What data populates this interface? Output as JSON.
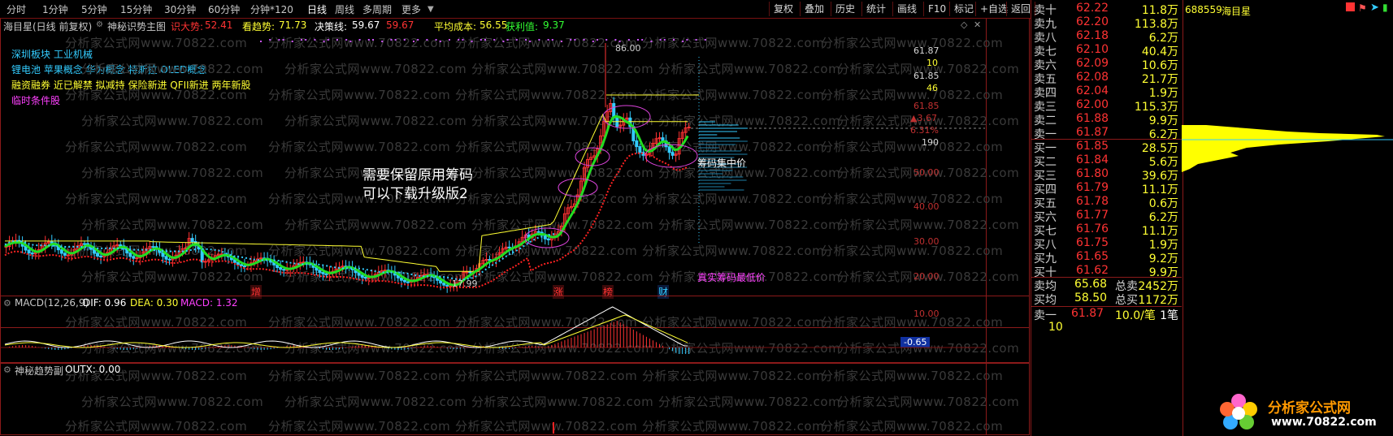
{
  "toolbar": {
    "periods": [
      "分时",
      "1分钟",
      "5分钟",
      "15分钟",
      "30分钟",
      "60分钟",
      "分钟*120",
      "日线",
      "周线",
      "多周期",
      "更多"
    ],
    "active_period": "日线",
    "right_buttons": [
      "复权",
      "叠加",
      "历史",
      "统计",
      "画线",
      "F10",
      "标记",
      "+自选",
      "返回"
    ]
  },
  "info": {
    "stock_label": "海目星(日线 前复权)",
    "indicator_name": "神秘识势主图",
    "sell_label": "识大势:",
    "sell_value": "52.41",
    "trend_label": "看趋势:",
    "trend_value": "71.73",
    "decision_label": "决策线:",
    "decision_value": "59.67",
    "decision_value2": "59.67",
    "avg_cost_label": "平均成本:",
    "avg_cost_value": "56.55",
    "profit_label": "获利值:",
    "profit_value": "9.37"
  },
  "concepts": {
    "line1": "深圳板块  工业机械",
    "line2": "锂电池  苹果概念  华为概念  特斯拉  OLED概念",
    "line3": "融资融券  近已解禁  拟减持  保险新进  QFII新进  两年新股",
    "line4": "临时条件股"
  },
  "annotations": {
    "note_line1": "需要保留原用筹码",
    "note_line2": "可以下载升级版2",
    "chip_center": "筹码集中价",
    "lowest_chip": "真实筹码最低价",
    "high_price": "86.00",
    "low_price": "17.99",
    "markers": [
      "增",
      "涨",
      "榜",
      "财"
    ]
  },
  "price_axis": {
    "top_value": "61.87",
    "top_sub": "10",
    "mid_value": "61.85",
    "mid_sub": "46",
    "current_price": "61.85",
    "change": "▲3.67",
    "change_pct": "6.31%",
    "vol_tag": "190",
    "ticks": [
      "50.00",
      "40.00",
      "30.00",
      "20.00"
    ]
  },
  "macd": {
    "title": "MACD(12,26,9)",
    "dif_label": "DIF: 0.96",
    "dea_label": "DEA: 0.30",
    "macd_label": "MACD: 1.32",
    "axis_top": "10.00",
    "axis_value": "-0.65"
  },
  "sub": {
    "title": "神秘趋势副",
    "outx": "OUTX: 0.00"
  },
  "watermark_text": "分析家公式网www.70822.com",
  "orderbook": {
    "stock_code": "688559",
    "stock_name": "海目星",
    "asks": [
      {
        "name": "卖十",
        "price": "62.22",
        "vol": "11.8万"
      },
      {
        "name": "卖九",
        "price": "62.20",
        "vol": "113.8万"
      },
      {
        "name": "卖八",
        "price": "62.18",
        "vol": "6.2万"
      },
      {
        "name": "卖七",
        "price": "62.10",
        "vol": "40.4万"
      },
      {
        "name": "卖六",
        "price": "62.09",
        "vol": "10.6万"
      },
      {
        "name": "卖五",
        "price": "62.08",
        "vol": "21.7万"
      },
      {
        "name": "卖四",
        "price": "62.04",
        "vol": "1.9万"
      },
      {
        "name": "卖三",
        "price": "62.00",
        "vol": "115.3万"
      },
      {
        "name": "卖二",
        "price": "61.88",
        "vol": "9.9万"
      },
      {
        "name": "卖一",
        "price": "61.87",
        "vol": "6.2万"
      }
    ],
    "bids": [
      {
        "name": "买一",
        "price": "61.85",
        "vol": "28.5万"
      },
      {
        "name": "买二",
        "price": "61.84",
        "vol": "5.6万"
      },
      {
        "name": "买三",
        "price": "61.80",
        "vol": "39.6万"
      },
      {
        "name": "买四",
        "price": "61.79",
        "vol": "11.1万"
      },
      {
        "name": "买五",
        "price": "61.78",
        "vol": "0.6万"
      },
      {
        "name": "买六",
        "price": "61.77",
        "vol": "6.2万"
      },
      {
        "name": "买七",
        "price": "61.76",
        "vol": "11.1万"
      },
      {
        "name": "买八",
        "price": "61.75",
        "vol": "1.9万"
      },
      {
        "name": "买九",
        "price": "61.65",
        "vol": "9.2万"
      },
      {
        "name": "买十",
        "price": "61.62",
        "vol": "9.9万"
      }
    ],
    "avg_ask_label": "卖均",
    "avg_ask": "65.68",
    "total_ask_label": "总卖",
    "total_ask": "2452万",
    "avg_bid_label": "买均",
    "avg_bid": "58.50",
    "total_bid_label": "总买",
    "total_bid": "1172万",
    "last_label": "卖一",
    "last_price": "61.87",
    "last_vol": "10.0/笔",
    "last_count": "1笔",
    "last_sub": "10"
  },
  "logo": {
    "title": "分析家公式网",
    "url": "www.70822.com"
  },
  "colors": {
    "up": "#ff3333",
    "down": "#33ccff",
    "frame": "#8b1a1a",
    "accent_yellow": "#ffff33",
    "green_line": "#33ff33"
  }
}
